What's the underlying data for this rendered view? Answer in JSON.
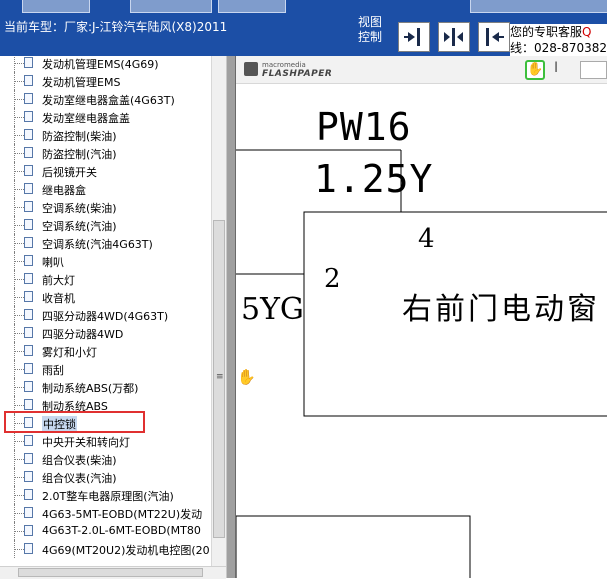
{
  "header": {
    "vehicle_label": "当前车型：厂家:J-江铃汽车陆风(X8)2011",
    "view_control_label": "视图控制",
    "customer_service_line1": "您的专职客服",
    "customer_service_line1_suffix": "Q",
    "customer_service_line2": "线：028-870382"
  },
  "tree": {
    "items": [
      {
        "label": "发动机管理EMS(4G69)"
      },
      {
        "label": "发动机管理EMS"
      },
      {
        "label": "发动室继电器盒盖(4G63T)"
      },
      {
        "label": "发动室继电器盒盖"
      },
      {
        "label": "防盗控制(柴油)"
      },
      {
        "label": "防盗控制(汽油)"
      },
      {
        "label": "后视镜开关"
      },
      {
        "label": "继电器盒"
      },
      {
        "label": "空调系统(柴油)"
      },
      {
        "label": "空调系统(汽油)"
      },
      {
        "label": "空调系统(汽油4G63T)"
      },
      {
        "label": "喇叭"
      },
      {
        "label": "前大灯"
      },
      {
        "label": "收音机"
      },
      {
        "label": "四驱分动器4WD(4G63T)"
      },
      {
        "label": "四驱分动器4WD"
      },
      {
        "label": "雾灯和小灯"
      },
      {
        "label": "雨刮"
      },
      {
        "label": "制动系统ABS(万都)"
      },
      {
        "label": "制动系统ABS"
      },
      {
        "label": "中控锁",
        "selected": true
      },
      {
        "label": "中央开关和转向灯"
      },
      {
        "label": "组合仪表(柴油)"
      },
      {
        "label": "组合仪表(汽油)"
      },
      {
        "label": "2.0T整车电器原理图(汽油)"
      },
      {
        "label": "4G63-5MT-EOBD(MT22U)发动"
      },
      {
        "label": "4G63T-2.0L-6MT-EOBD(MT80"
      },
      {
        "label": "4G69(MT20U2)发动机电控图(20"
      }
    ]
  },
  "viewer": {
    "logo_top": "macromedia",
    "logo_main": "FLASHPAPER",
    "text_tool_glyph": "I"
  },
  "diagram": {
    "wire_code": "PW16",
    "wire_spec": "1.25Y",
    "pin_top": "4",
    "pin_left": "2",
    "left_wire": "5YG",
    "component_name": "右前门电动窗"
  },
  "colors": {
    "header_bg": "#1c4fa6",
    "selection_bg": "#c6d7ee",
    "highlight_border": "#e03030",
    "service_accent": "#d00000",
    "tool_active_border": "#3cbf3c"
  }
}
